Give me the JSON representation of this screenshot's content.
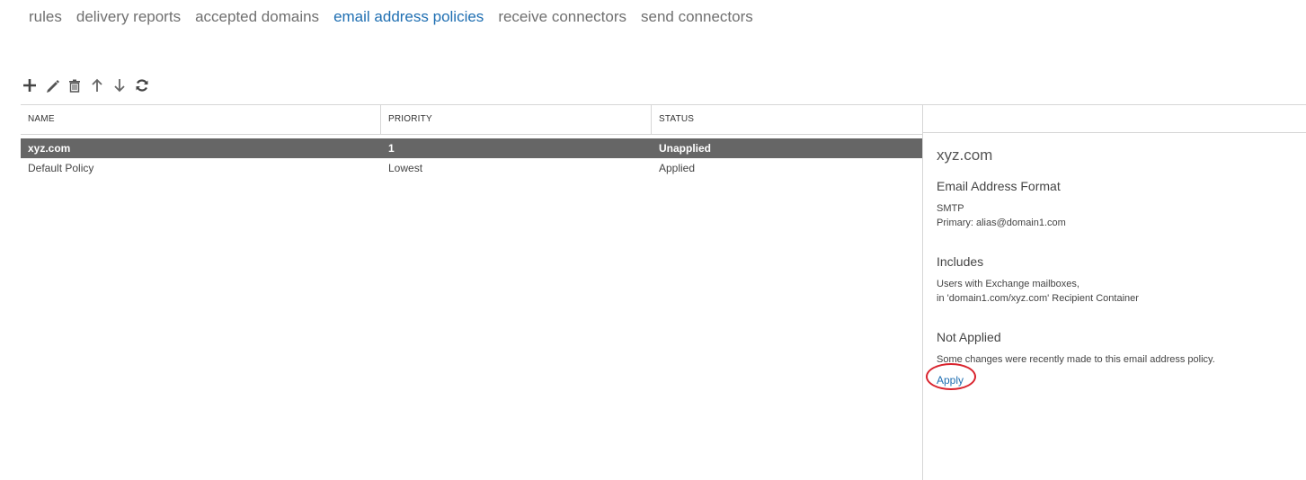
{
  "tabs": [
    {
      "label": "rules"
    },
    {
      "label": "delivery reports"
    },
    {
      "label": "accepted domains"
    },
    {
      "label": "email address policies",
      "active": true
    },
    {
      "label": "receive connectors"
    },
    {
      "label": "send connectors"
    }
  ],
  "toolbar": {
    "icons": [
      "add-icon",
      "edit-icon",
      "delete-icon",
      "move-up-icon",
      "move-down-icon",
      "refresh-icon"
    ]
  },
  "table": {
    "columns": [
      "NAME",
      "PRIORITY",
      "STATUS"
    ],
    "rows": [
      {
        "name": "xyz.com",
        "priority": "1",
        "status": "Unapplied",
        "selected": true
      },
      {
        "name": "Default Policy",
        "priority": "Lowest",
        "status": "Applied",
        "selected": false
      }
    ]
  },
  "details": {
    "title": "xyz.com",
    "format_heading": "Email Address Format",
    "format_line1": "SMTP",
    "format_line2": "Primary: alias@domain1.com",
    "includes_heading": "Includes",
    "includes_line1": "Users with Exchange mailboxes,",
    "includes_line2": "in 'domain1.com/xyz.com' Recipient Container",
    "status_heading": "Not Applied",
    "status_text": "Some changes were recently made to this email address policy.",
    "apply_label": "Apply"
  },
  "colors": {
    "accent": "#1f6fb2",
    "selected_row": "#666666",
    "annotation_circle": "#d9232d"
  }
}
